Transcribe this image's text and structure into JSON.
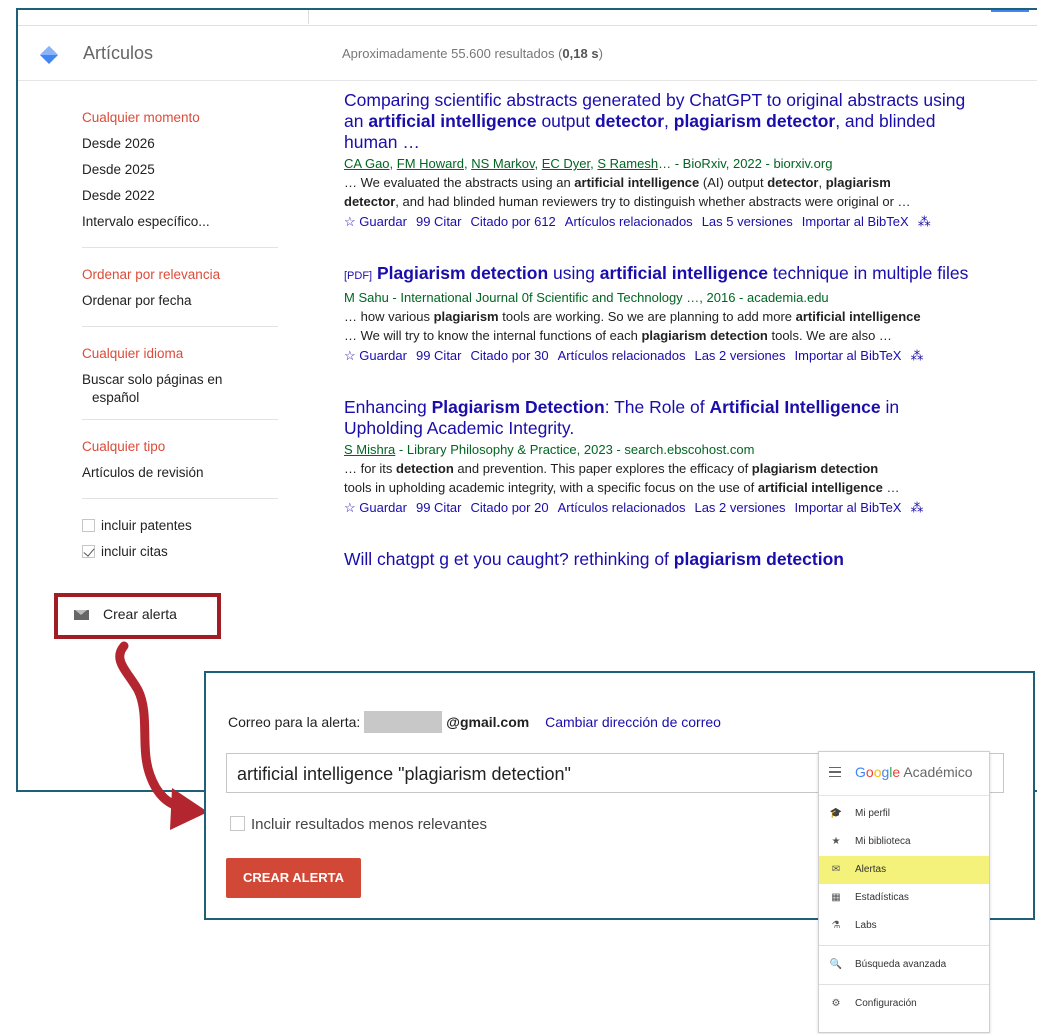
{
  "header": {
    "title": "Artículos",
    "count_prefix": "Aproximadamente 55.600 resultados (",
    "count_time": "0,18 s",
    "count_suffix": ")"
  },
  "sidebar": {
    "time": [
      "Cualquier momento",
      "Desde 2026",
      "Desde 2025",
      "Desde 2022",
      "Intervalo específico..."
    ],
    "sort": [
      "Ordenar por relevancia",
      "Ordenar por fecha"
    ],
    "lang": [
      "Cualquier idioma",
      "Buscar solo páginas en",
      "español"
    ],
    "type": [
      "Cualquier tipo",
      "Artículos de revisión"
    ],
    "patents": "incluir patentes",
    "citations": "incluir citas",
    "create_alert": "Crear alerta"
  },
  "results": [
    {
      "title_parts": [
        "Comparing scientific abstracts generated by ChatGPT to original abstracts using",
        "an ",
        "artificial intelligence",
        " output ",
        "detector",
        ", ",
        "plagiarism detector",
        ", and blinded",
        "human …"
      ],
      "authors_linked": [
        "CA Gao",
        "FM Howard",
        "NS Markov",
        "EC Dyer",
        "S Ramesh"
      ],
      "authors_rest": "… - BioRxiv, 2022 - biorxiv.org",
      "snippet1_parts": [
        "… We evaluated the abstracts using an ",
        "artificial intelligence",
        " (AI) output ",
        "detector",
        ", ",
        "plagiarism"
      ],
      "snippet2_parts": [
        "detector",
        ", and had blinded human reviewers try to distinguish whether abstracts were original or …"
      ],
      "links": [
        "☆ Guardar",
        "99 Citar",
        "Citado por 612",
        "Artículos relacionados",
        "Las 5 versiones",
        "Importar al BibTeX",
        "⁂"
      ]
    },
    {
      "pdf": "[PDF]",
      "title_parts": [
        "Plagiarism detection",
        " using ",
        "artificial intelligence",
        " technique in multiple files"
      ],
      "authors_rest": "M Sahu - International Journal 0f Scientific and Technology …, 2016 - academia.edu",
      "snippet1_parts": [
        "… how various ",
        "plagiarism",
        " tools are working. So we are planning to add more ",
        "artificial intelligence"
      ],
      "snippet2_parts": [
        "… We will try to know the internal functions of each ",
        "plagiarism detection",
        " tools. We are also …"
      ],
      "links": [
        "☆ Guardar",
        "99 Citar",
        "Citado por 30",
        "Artículos relacionados",
        "Las 2 versiones",
        "Importar al BibTeX",
        "⁂"
      ]
    },
    {
      "title_parts": [
        "Enhancing ",
        "Plagiarism Detection",
        ": The Role of ",
        "Artificial Intelligence",
        " in",
        "Upholding Academic Integrity."
      ],
      "authors_linked": [
        "S Mishra"
      ],
      "authors_rest": " - Library Philosophy & Practice, 2023 - search.ebscohost.com",
      "snippet1_parts": [
        "… for its ",
        "detection",
        " and prevention. This paper explores the efficacy of ",
        "plagiarism detection"
      ],
      "snippet2_parts": [
        "tools in upholding academic integrity, with a specific focus on the use of ",
        "artificial intelligence",
        " …"
      ],
      "links": [
        "☆ Guardar",
        "99 Citar",
        "Citado por 20",
        "Artículos relacionados",
        "Las 2 versiones",
        "Importar al BibTeX",
        "⁂"
      ]
    },
    {
      "title_parts": [
        "Will chatgpt g et you caught? rethinking of ",
        "plagiarism detection"
      ]
    }
  ],
  "popup": {
    "email_label": "Correo para la alerta:",
    "email_domain": "@gmail.com",
    "change_email": "Cambiar dirección de correo",
    "query": "artificial intelligence  \"plagiarism detection\"",
    "include_less": "Incluir resultados menos relevantes",
    "create_button": "CREAR ALERTA"
  },
  "gmenu": {
    "brand_suffix": " Académico",
    "items": [
      {
        "icon": "graduation-cap-icon",
        "glyph": "🎓",
        "label": "Mi perfil"
      },
      {
        "icon": "star-icon",
        "glyph": "★",
        "label": "Mi biblioteca"
      },
      {
        "icon": "envelope-icon",
        "glyph": "✉",
        "label": "Alertas"
      },
      {
        "icon": "stats-icon",
        "glyph": "▦",
        "label": "Estadísticas"
      },
      {
        "icon": "flask-icon",
        "glyph": "⚗",
        "label": "Labs"
      },
      {
        "icon": "advanced-search-icon",
        "glyph": "🔍",
        "label": "Búsqueda avanzada"
      },
      {
        "icon": "gear-icon",
        "glyph": "⚙",
        "label": "Configuración"
      }
    ]
  },
  "colors": {
    "accent_red": "#dd4b39",
    "link": "#1a0dab",
    "authors": "#006621",
    "highlight": "#f4f27a",
    "frame": "#1e5f79",
    "callout": "#a11d24"
  }
}
